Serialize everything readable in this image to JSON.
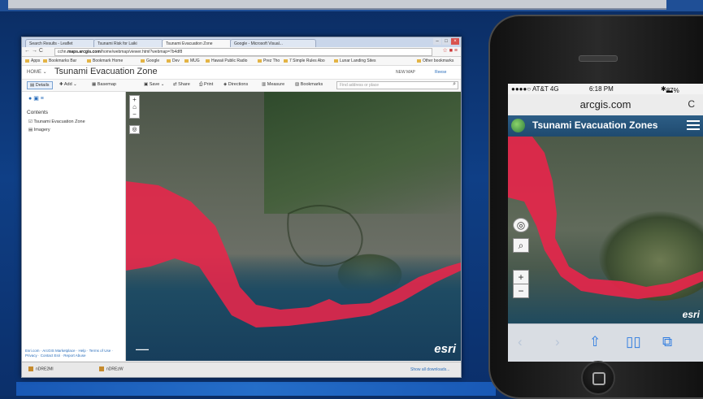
{
  "desktop": {
    "tabs": [
      {
        "label": "Search Results - Leaflet"
      },
      {
        "label": "Tsunami Risk for Laiki"
      },
      {
        "label": "Tsunami Evacuation Zone"
      },
      {
        "label": "Google - Microsoft Visual..."
      }
    ],
    "url_prefix": "cchn.",
    "url_domain": "maps.arcgis.com",
    "url_path": "/home/webmap/viewer.html?webmap=7b4df8",
    "bookmarks": [
      "Apps",
      "Bookmarks Bar",
      "Bookmark Home",
      "Google",
      "Dev",
      "MUG",
      "Hawaii Public Radio",
      "Prez Tho",
      "7 Simple Rules Abo",
      "Lunar Landing Sites",
      "Other bookmarks"
    ],
    "home_label": "HOME",
    "map_title": "Tsunami Evacuation Zone",
    "new_map_label": "NEW MAP",
    "user_label": "Reese",
    "toolbar": {
      "details": "Details",
      "add": "Add",
      "basemap": "Basemap",
      "save": "Save",
      "share": "Share",
      "print": "Print",
      "directions": "Directions",
      "measure": "Measure",
      "bookmarks": "Bookmarks"
    },
    "search_placeholder": "Find address or place",
    "contents_label": "Contents",
    "layers": [
      "Tsunami Evacuation Zone",
      "Imagery"
    ],
    "footer_links": "Esri.com · ArcGIS Marketplace · Help · Terms of Use · Privacy · Contact Esri · Report Abuse",
    "downloads": [
      "nDRE2MI",
      "nDREzW"
    ],
    "show_all_downloads": "Show all downloads...",
    "esri_logo": "esri"
  },
  "phone": {
    "carrier": "●●●●○ AT&T  4G",
    "time": "6:18 PM",
    "battery": "87%",
    "url": "arcgis.com",
    "app_title": "Tsunami Evacuation Zones",
    "esri_logo": "esri"
  },
  "colors": {
    "evacuation_zone": "#e8254a",
    "background": "#0f3f86",
    "ios_blue": "#2f7ce0"
  }
}
